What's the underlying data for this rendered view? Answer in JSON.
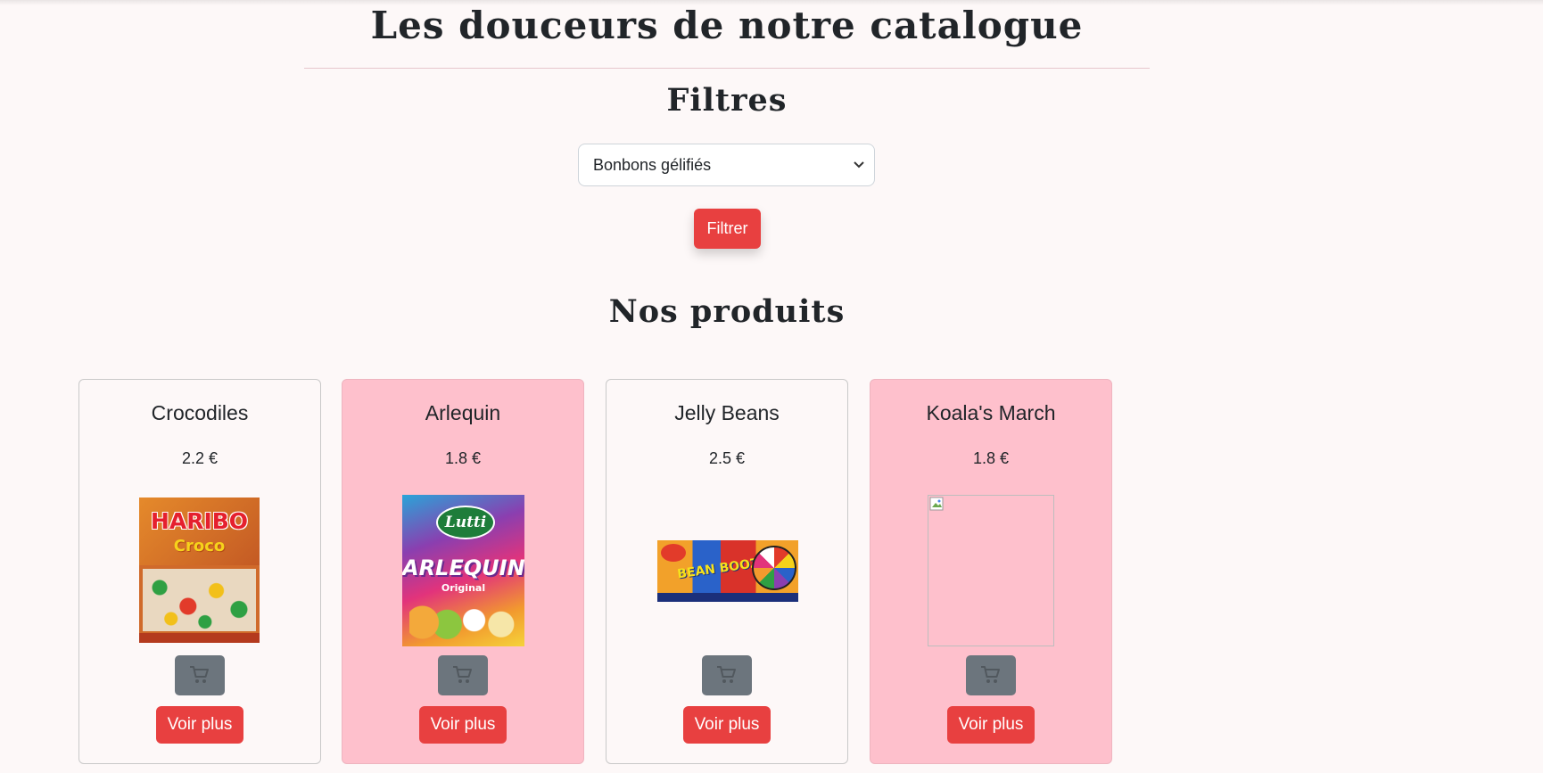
{
  "page": {
    "title": "Les douceurs de notre catalogue",
    "filters_title": "Filtres",
    "products_title": "Nos produits"
  },
  "filter": {
    "selected": "Bonbons gélifiés",
    "button_label": "Filtrer"
  },
  "colors": {
    "background": "#fdf8f8",
    "accent": "#e84040",
    "card_pink": "#fec0cc",
    "cart_button": "#6c757d"
  },
  "products": [
    {
      "name": "Crocodiles",
      "price": "2.2 €",
      "more_label": "Voir plus",
      "image_icon": "haribo-croco-bag",
      "image_brand": "HARIBO",
      "image_product": "Croco"
    },
    {
      "name": "Arlequin",
      "price": "1.8 €",
      "more_label": "Voir plus",
      "image_icon": "lutti-arlequin-bag",
      "image_brand": "Lutti",
      "image_product": "ARLEQUIN",
      "image_variant": "Original"
    },
    {
      "name": "Jelly Beans",
      "price": "2.5 €",
      "more_label": "Voir plus",
      "image_icon": "bean-boozled-box",
      "image_text": "BEAN BOOZLED"
    },
    {
      "name": "Koala's March",
      "price": "1.8 €",
      "more_label": "Voir plus",
      "image_icon": "broken-image-icon"
    }
  ],
  "icons": {
    "cart": "shopping-cart-icon",
    "dropdown": "chevron-down-icon"
  }
}
